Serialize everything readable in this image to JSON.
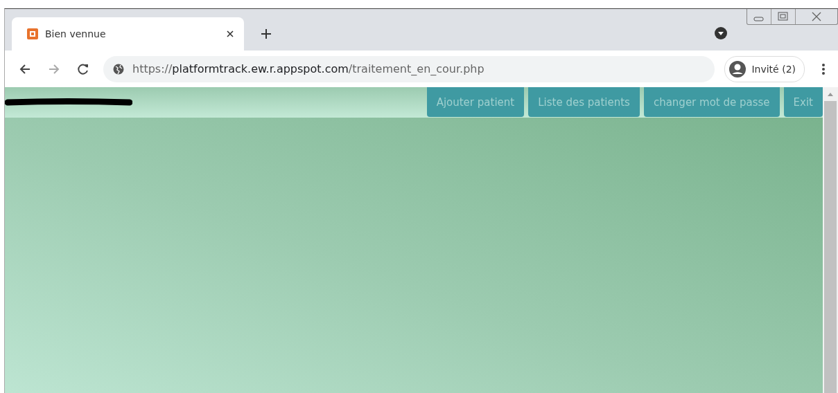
{
  "browser": {
    "tabs": [
      {
        "title": "Bien vennue",
        "selected": true
      }
    ],
    "url": {
      "scheme": "https://",
      "host": "platformtrack.ew.r.appspot.com",
      "path": "/traitement_en_cour.php"
    },
    "profile": "Invité (2)"
  },
  "page": {
    "nav_buttons": [
      "Ajouter patient",
      "Liste des patients",
      "changer mot de passe",
      "Exit"
    ]
  }
}
